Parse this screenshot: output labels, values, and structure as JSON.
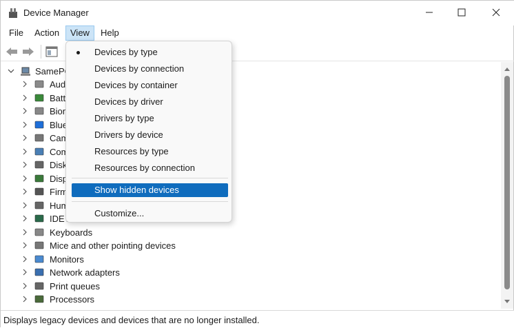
{
  "window": {
    "title": "Device Manager"
  },
  "menu": {
    "file": "File",
    "action": "Action",
    "view": "View",
    "help": "Help"
  },
  "tree": {
    "root": "SamePC",
    "items": [
      {
        "label": "Aud",
        "icon": "audio-icon"
      },
      {
        "label": "Batt",
        "icon": "battery-icon"
      },
      {
        "label": "Bion",
        "icon": "biometric-icon"
      },
      {
        "label": "Blue",
        "icon": "bluetooth-icon"
      },
      {
        "label": "Cam",
        "icon": "camera-icon"
      },
      {
        "label": "Com",
        "icon": "computer-icon"
      },
      {
        "label": "Disk",
        "icon": "disk-icon"
      },
      {
        "label": "Disp",
        "icon": "display-icon"
      },
      {
        "label": "Firm",
        "icon": "firmware-icon"
      },
      {
        "label": "Hum",
        "icon": "hid-icon"
      },
      {
        "label": "IDE A",
        "icon": "ide-icon"
      },
      {
        "label": "Keyboards",
        "icon": "keyboard-icon"
      },
      {
        "label": "Mice and other pointing devices",
        "icon": "mouse-icon"
      },
      {
        "label": "Monitors",
        "icon": "monitor-icon"
      },
      {
        "label": "Network adapters",
        "icon": "network-icon"
      },
      {
        "label": "Print queues",
        "icon": "printer-icon"
      },
      {
        "label": "Processors",
        "icon": "processor-icon"
      }
    ]
  },
  "view_menu": {
    "items": [
      {
        "label": "Devices by type",
        "checked": true
      },
      {
        "label": "Devices by connection"
      },
      {
        "label": "Devices by container"
      },
      {
        "label": "Devices by driver"
      },
      {
        "label": "Drivers by type"
      },
      {
        "label": "Drivers by device"
      },
      {
        "label": "Resources by type"
      },
      {
        "label": "Resources by connection"
      },
      {
        "label": "Show hidden devices",
        "selected": true
      },
      {
        "label": "Customize..."
      }
    ]
  },
  "status": {
    "text": "Displays legacy devices and devices that are no longer installed."
  },
  "colors": {
    "selection": "#0f6cbd",
    "menu_highlight": "#cce4f7"
  }
}
